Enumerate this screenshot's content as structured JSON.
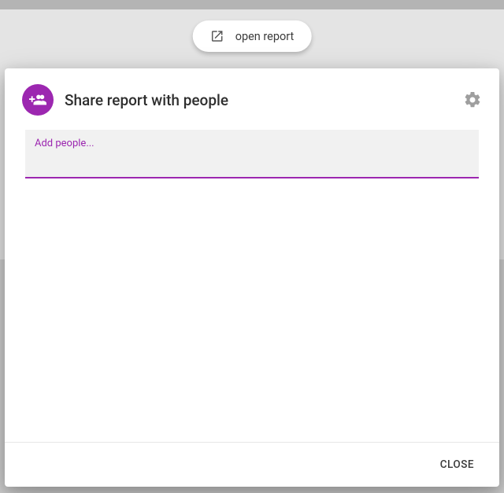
{
  "top_button": {
    "label": "open report",
    "icon": "open-in-new-icon"
  },
  "dialog": {
    "title": "Share report with people",
    "icon": "group-add-icon",
    "settings_icon": "gear-icon",
    "input": {
      "label": "Add people...",
      "value": ""
    },
    "close_label": "CLOSE"
  },
  "colors": {
    "accent": "#9c27b0"
  }
}
